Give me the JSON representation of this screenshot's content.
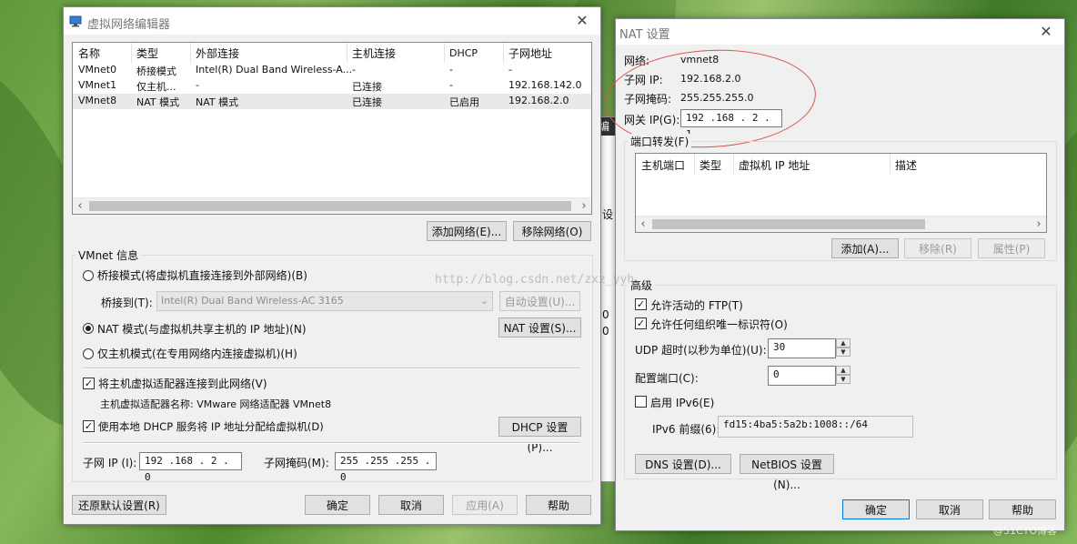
{
  "vne": {
    "title": "虚拟网络编辑器",
    "columns": [
      "名称",
      "类型",
      "外部连接",
      "主机连接",
      "DHCP",
      "子网地址"
    ],
    "rows": [
      [
        "VMnet0",
        "桥接模式",
        "Intel(R) Dual Band Wireless-A...",
        "-",
        "-",
        "-"
      ],
      [
        "VMnet1",
        "仅主机...",
        "-",
        "已连接",
        "-",
        "192.168.142.0"
      ],
      [
        "VMnet8",
        "NAT 模式",
        "NAT 模式",
        "已连接",
        "已启用",
        "192.168.2.0"
      ]
    ],
    "add_network": "添加网络(E)...",
    "remove_network": "移除网络(O)",
    "vmnet_info": "VMnet 信息",
    "bridged_radio": "桥接模式(将虚拟机直接连接到外部网络)(B)",
    "bridge_to_label": "桥接到(T):",
    "bridge_to_value": "Intel(R) Dual Band Wireless-AC 3165",
    "auto_settings": "自动设置(U)...",
    "nat_radio": "NAT 模式(与虚拟机共享主机的 IP 地址)(N)",
    "nat_settings": "NAT 设置(S)...",
    "hostonly_radio": "仅主机模式(在专用网络内连接虚拟机)(H)",
    "connect_adapter": "将主机虚拟适配器连接到此网络(V)",
    "adapter_name": "主机虚拟适配器名称: VMware 网络适配器 VMnet8",
    "use_dhcp": "使用本地 DHCP 服务将 IP 地址分配给虚拟机(D)",
    "dhcp_settings": "DHCP 设置(P)...",
    "subnet_ip_label": "子网 IP (I):",
    "subnet_ip_value": "192 .168 . 2  . 0",
    "subnet_mask_label": "子网掩码(M):",
    "subnet_mask_value": "255 .255 .255 . 0",
    "restore_defaults": "还原默认设置(R)",
    "ok": "确定",
    "cancel": "取消",
    "apply": "应用(A)",
    "help": "帮助"
  },
  "nat": {
    "title": "NAT 设置",
    "network_label": "网络:",
    "network_value": "vmnet8",
    "subnet_ip_label": "子网 IP:",
    "subnet_ip_value": "192.168.2.0",
    "subnet_mask_label": "子网掩码:",
    "subnet_mask_value": "255.255.255.0",
    "gateway_label": "网关 IP(G):",
    "gateway_value": "192 .168 . 2  . 1",
    "port_forwarding": "端口转发(F)",
    "pf_columns": [
      "主机端口",
      "类型",
      "虚拟机 IP 地址",
      "描述"
    ],
    "add": "添加(A)...",
    "remove": "移除(R)",
    "properties": "属性(P)",
    "advanced": "高级",
    "allow_ftp": "允许活动的 FTP(T)",
    "allow_oui": "允许任何组织唯一标识符(O)",
    "udp_timeout_label": "UDP 超时(以秒为单位)(U):",
    "udp_timeout_value": "30",
    "config_port_label": "配置端口(C):",
    "config_port_value": "0",
    "enable_ipv6": "启用 IPv6(E)",
    "ipv6_prefix_label": "IPv6 前缀(6):",
    "ipv6_prefix_value": "fd15:4ba5:5a2b:1008::/64",
    "dns_settings": "DNS 设置(D)...",
    "netbios_settings": "NetBIOS 设置(N)...",
    "ok": "确定",
    "cancel": "取消",
    "help": "帮助"
  },
  "bg": {
    "snip1": "编",
    "snip2": "设",
    "snip3": "0",
    "snip4": "0"
  },
  "watermark": "http://blog.csdn.net/zxz_yyh",
  "corner_watermark": "@51CTO博客",
  "colors": {
    "annotation_red": "#d9534f",
    "focus_blue": "#0078d7"
  }
}
